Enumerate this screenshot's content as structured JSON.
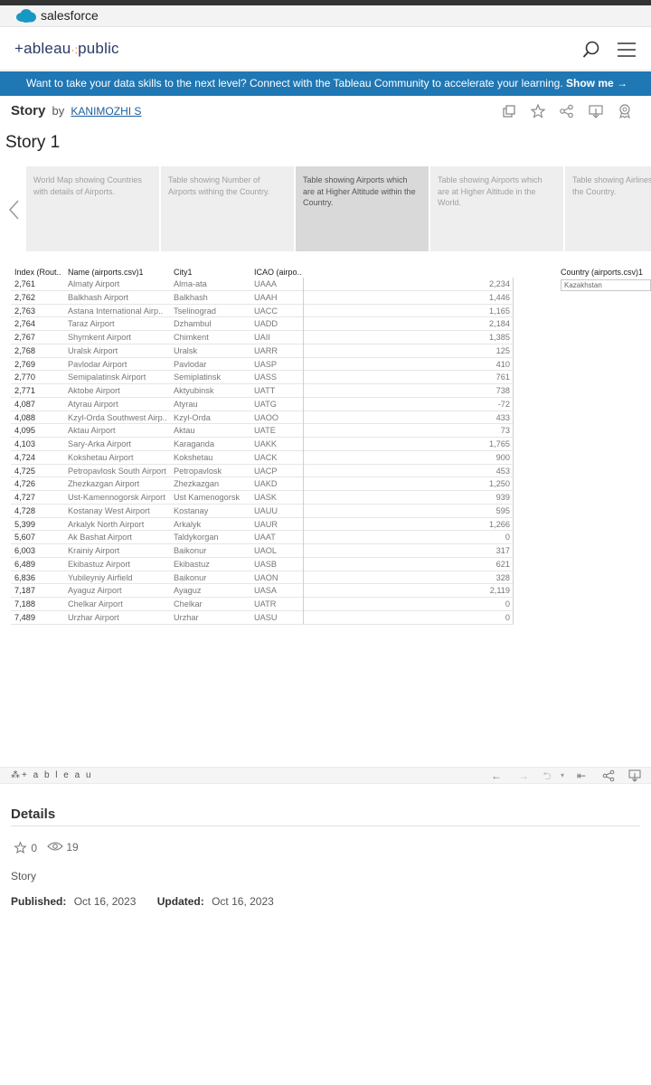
{
  "salesforce": {
    "label": "salesforce"
  },
  "header": {
    "logo_main": "+ableau",
    "logo_sep": "·:",
    "logo_public": "public"
  },
  "banner": {
    "text": "Want to take your data skills to the next level? Connect with the Tableau Community to accelerate your learning.",
    "link": "Show me →"
  },
  "story": {
    "label": "Story",
    "by": "by",
    "author": "KANIMOZHI S",
    "title": "Story 1"
  },
  "story_points": [
    "World Map showing Countries with details of Airports.",
    "Table showing Number of Airports withing the Country.",
    "Table showing Airports which are at Higher Altitude within the Country.",
    "Table showing Airports which are at Higher Altitude in the World.",
    "Table showing Airlines in the Country."
  ],
  "table": {
    "headers": [
      "Index (Rout..",
      "Name (airports.csv)1",
      "City1",
      "ICAO (airpo.."
    ],
    "rows": [
      [
        "2,761",
        "Almaty Airport",
        "Alma-ata",
        "UAAA",
        "2,234"
      ],
      [
        "2,762",
        "Balkhash Airport",
        "Balkhash",
        "UAAH",
        "1,446"
      ],
      [
        "2,763",
        "Astana International Airp..",
        "Tselinograd",
        "UACC",
        "1,165"
      ],
      [
        "2,764",
        "Taraz Airport",
        "Dzhambul",
        "UADD",
        "2,184"
      ],
      [
        "2,767",
        "Shymkent Airport",
        "Chimkent",
        "UAII",
        "1,385"
      ],
      [
        "2,768",
        "Uralsk Airport",
        "Uralsk",
        "UARR",
        "125"
      ],
      [
        "2,769",
        "Pavlodar Airport",
        "Pavlodar",
        "UASP",
        "410"
      ],
      [
        "2,770",
        "Semipalatinsk Airport",
        "Semiplatinsk",
        "UASS",
        "761"
      ],
      [
        "2,771",
        "Aktobe Airport",
        "Aktyubinsk",
        "UATT",
        "738"
      ],
      [
        "4,087",
        "Atyrau Airport",
        "Atyrau",
        "UATG",
        "-72"
      ],
      [
        "4,088",
        "Kzyl-Orda Southwest Airp..",
        "Kzyl-Orda",
        "UAOO",
        "433"
      ],
      [
        "4,095",
        "Aktau Airport",
        "Aktau",
        "UATE",
        "73"
      ],
      [
        "4,103",
        "Sary-Arka Airport",
        "Karaganda",
        "UAKK",
        "1,765"
      ],
      [
        "4,724",
        "Kokshetau Airport",
        "Kokshetau",
        "UACK",
        "900"
      ],
      [
        "4,725",
        "Petropavlosk South Airport",
        "Petropavlosk",
        "UACP",
        "453"
      ],
      [
        "4,726",
        "Zhezkazgan Airport",
        "Zhezkazgan",
        "UAKD",
        "1,250"
      ],
      [
        "4,727",
        "Ust-Kamennogorsk Airport",
        "Ust Kamenogorsk",
        "UASK",
        "939"
      ],
      [
        "4,728",
        "Kostanay West Airport",
        "Kostanay",
        "UAUU",
        "595"
      ],
      [
        "5,399",
        "Arkalyk North Airport",
        "Arkalyk",
        "UAUR",
        "1,266"
      ],
      [
        "5,607",
        "Ak Bashat Airport",
        "Taldykorgan",
        "UAAT",
        "0"
      ],
      [
        "6,003",
        "Krainiy Airport",
        "Baikonur",
        "UAOL",
        "317"
      ],
      [
        "6,489",
        "Ekibastuz Airport",
        "Ekibastuz",
        "UASB",
        "621"
      ],
      [
        "6,836",
        "Yubileyniy Airfield",
        "Baikonur",
        "UAON",
        "328"
      ],
      [
        "7,187",
        "Ayaguz Airport",
        "Ayaguz",
        "UASA",
        "2,119"
      ],
      [
        "7,188",
        "Chelkar Airport",
        "Chelkar",
        "UATR",
        "0"
      ],
      [
        "7,489",
        "Urzhar Airport",
        "Urzhar",
        "UASU",
        "0"
      ]
    ]
  },
  "filter": {
    "label": "Country (airports.csv)1",
    "value": "Kazakhstan"
  },
  "viz_toolbar": {
    "logo": "+ a b l e a u"
  },
  "details": {
    "heading": "Details",
    "favorites": "0",
    "views": "19",
    "type": "Story",
    "published_label": "Published:",
    "published": "Oct 16, 2023",
    "updated_label": "Updated:",
    "updated": "Oct 16, 2023"
  },
  "colors": {
    "banner": "#1f77b4",
    "active_point": "#d9d9d9",
    "point": "#eeeeee",
    "logo": "#2b3a67"
  }
}
